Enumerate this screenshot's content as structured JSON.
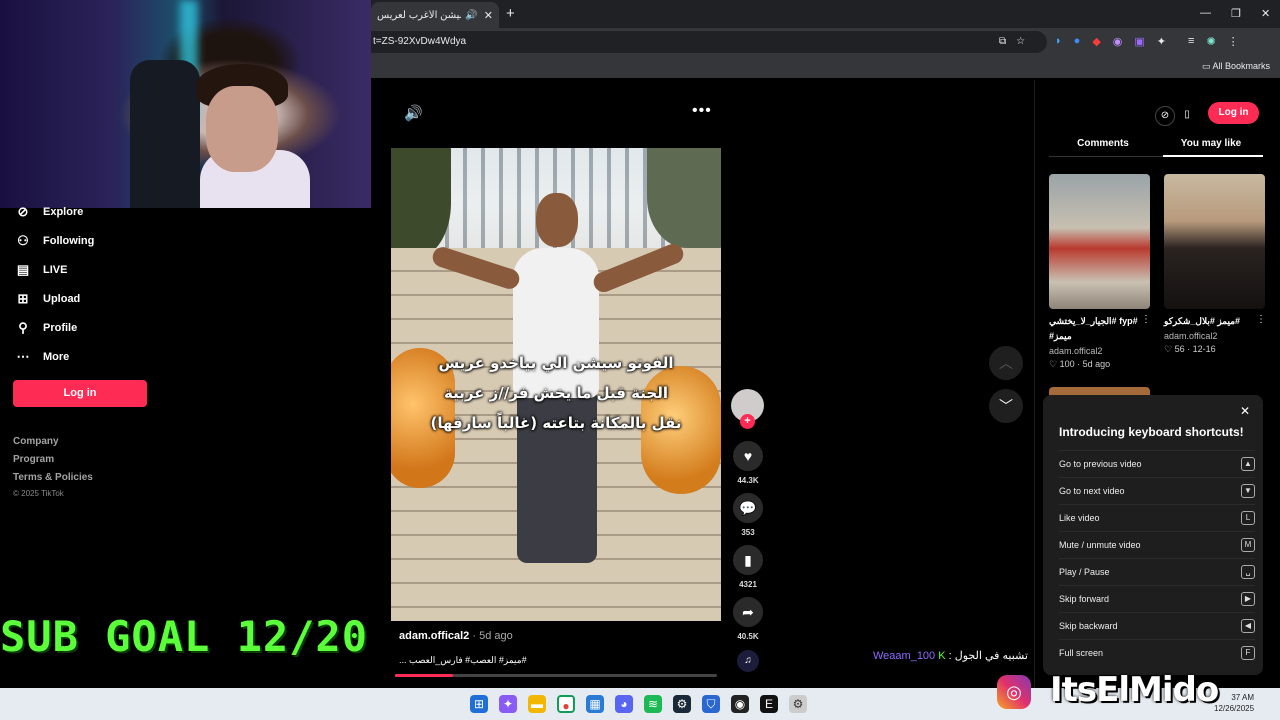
{
  "browser": {
    "tab_title": "الفوتو سيشن الأغرب لعريس",
    "tab_audio_icon": "speaker-icon",
    "url_fragment": "t=ZS-92XvDw4Wdya",
    "bookmarks_label": "All Bookmarks"
  },
  "sidebar": {
    "items": [
      {
        "label": "Explore",
        "icon": "compass-icon"
      },
      {
        "label": "Following",
        "icon": "person-icon"
      },
      {
        "label": "LIVE",
        "icon": "tv-icon"
      },
      {
        "label": "Upload",
        "icon": "plus-square-icon"
      },
      {
        "label": "Profile",
        "icon": "person-icon"
      },
      {
        "label": "More",
        "icon": "dots-icon"
      }
    ],
    "login_label": "Log in",
    "footer_links": [
      "Company",
      "Program",
      "Terms & Policies"
    ],
    "copyright": "© 2025 TikTok"
  },
  "video": {
    "caption_lines": [
      "الفوتو سيشن الي بياخدو عريس",
      "الجنة قبل ما يخش فر//ز عربية",
      "نقل بالمكانة بتاعته (غالباً سارقها)"
    ],
    "author": "adam.offical2",
    "posted": "5d ago",
    "hashtags": "... ميمز# العصب# فارس_العصب#",
    "progress": 0.18
  },
  "actions": {
    "likes": "44.3K",
    "comments": "353",
    "saves": "4321",
    "shares": "40.5K"
  },
  "right_panel": {
    "login_label": "Log in",
    "tabs": [
      "Comments",
      "You may like"
    ],
    "active_tab": "You may like",
    "suggestions": [
      {
        "title": "#fyp #الجيار_لا_يختشي",
        "title2": "#ميمز",
        "author": "adam.offical2",
        "meta": "100 · 5d ago"
      },
      {
        "title": "#ميمز #بلال_شكركو",
        "title2": "",
        "author": "adam.offical2",
        "meta": "56 · 12-16"
      }
    ]
  },
  "shortcuts": {
    "title": "Introducing keyboard shortcuts!",
    "rows": [
      {
        "label": "Go to previous video",
        "key": "▲"
      },
      {
        "label": "Go to next video",
        "key": "▼"
      },
      {
        "label": "Like video",
        "key": "L"
      },
      {
        "label": "Mute / unmute video",
        "key": "M"
      },
      {
        "label": "Play / Pause",
        "key": "␣"
      },
      {
        "label": "Skip forward",
        "key": "▶"
      },
      {
        "label": "Skip backward",
        "key": "◀"
      },
      {
        "label": "Full screen",
        "key": "F"
      }
    ]
  },
  "overlay": {
    "sub_goal": "SUB GOAL 12/20",
    "chat_user": "Weaam_100",
    "chat_message": "تشبيه في الجول",
    "brand": "ItsElMido"
  },
  "taskbar": {
    "time": "37 AM",
    "date": "12/26/2025"
  },
  "colors": {
    "accent": "#fe2c55",
    "sub_goal": "#5bff3a"
  }
}
